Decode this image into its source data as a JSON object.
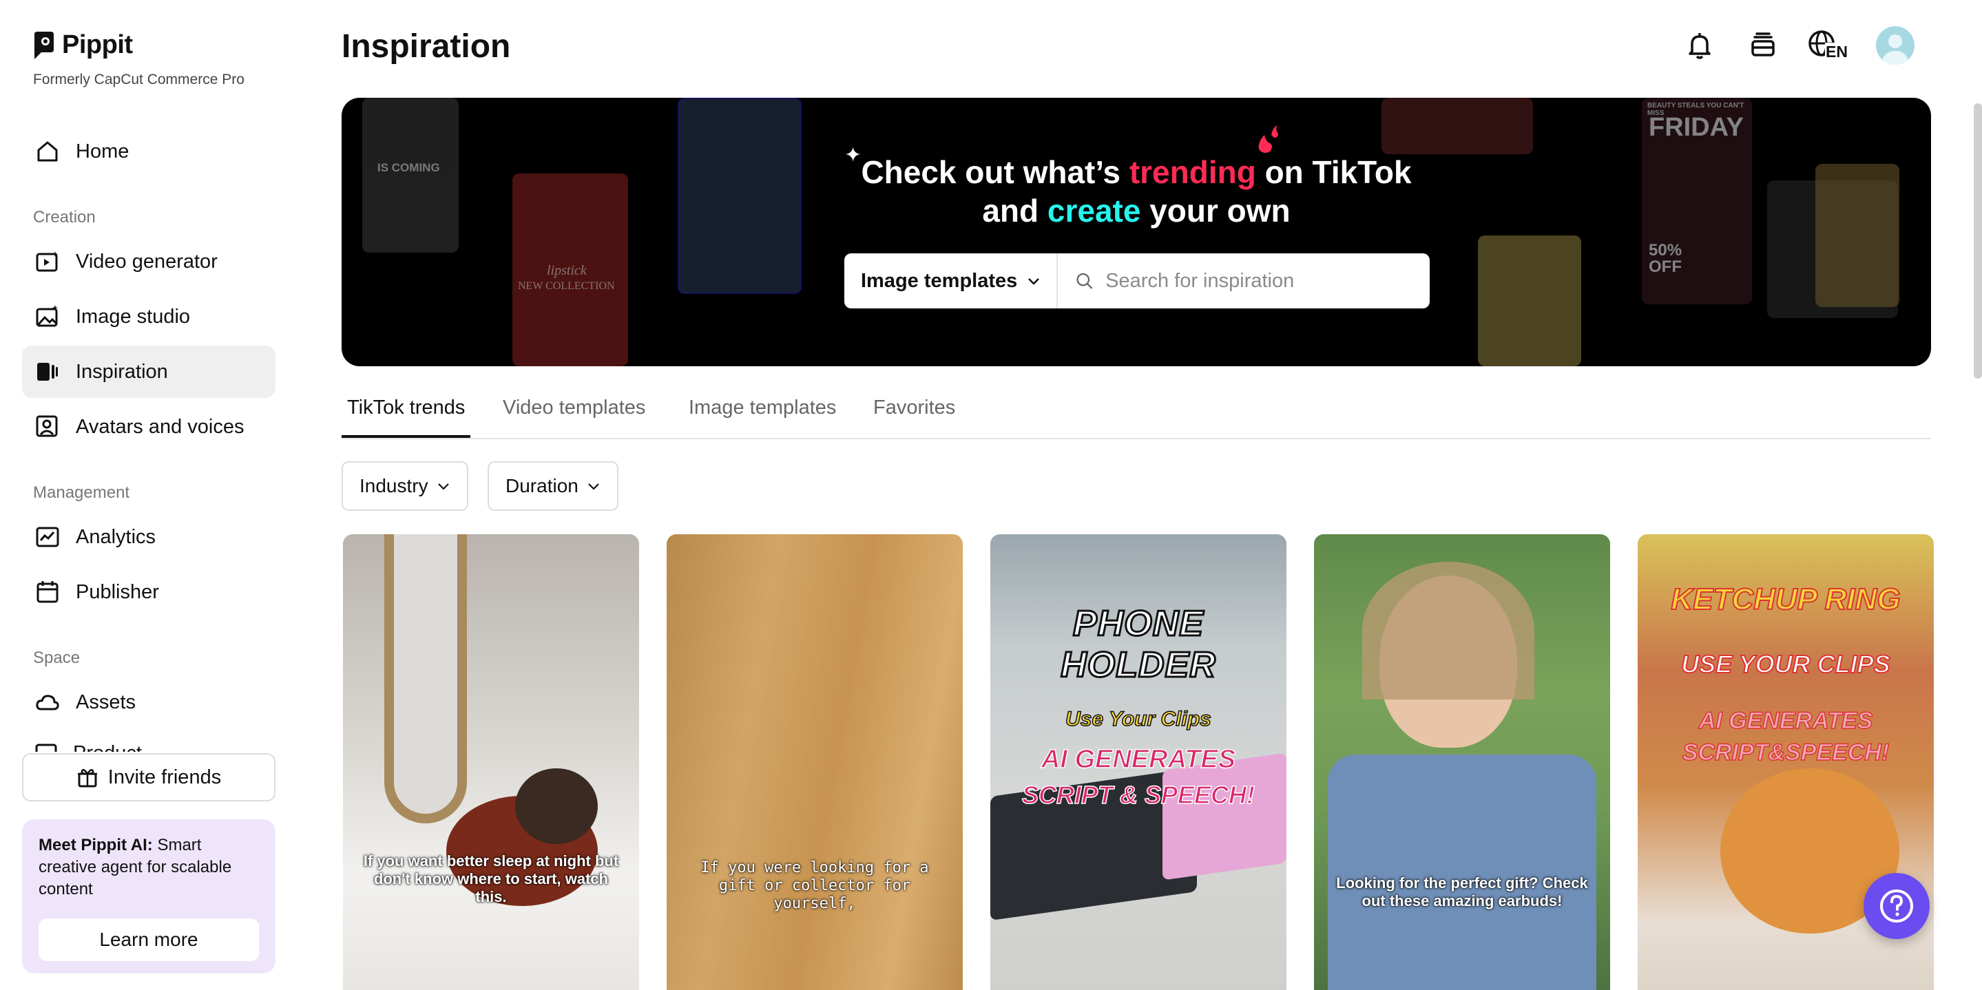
{
  "brand": {
    "name": "Pippit",
    "subtitle": "Formerly CapCut Commerce Pro"
  },
  "sidebar": {
    "home": "Home",
    "sections": {
      "creation": "Creation",
      "management": "Management",
      "space": "Space"
    },
    "items": {
      "video_generator": "Video generator",
      "image_studio": "Image studio",
      "inspiration": "Inspiration",
      "avatars": "Avatars and voices",
      "analytics": "Analytics",
      "publisher": "Publisher",
      "assets": "Assets",
      "products_partial": "Product"
    },
    "invite": "Invite friends",
    "promo": {
      "bold": "Meet Pippit AI:",
      "text": " Smart creative agent for scalable content",
      "button": "Learn more"
    }
  },
  "header": {
    "title": "Inspiration",
    "language": "EN"
  },
  "hero": {
    "line1_a": "Check out what’s ",
    "line1_highlight": "trending",
    "line1_b": " on TikTok",
    "line2_a": "and ",
    "line2_highlight": "create",
    "line2_b": " your own",
    "select_value": "Image templates",
    "search_placeholder": "Search for inspiration",
    "thumbs": {
      "coming": "IS COMING",
      "lipstick": "lipstick",
      "collection": "NEW COLLECTION",
      "friday": "FRIDAY",
      "off": "50% OFF",
      "beauty": "BEAUTY STEALS YOU CAN'T MISS"
    }
  },
  "tabs": [
    "TikTok trends",
    "Video templates",
    "Image templates",
    "Favorites"
  ],
  "filters": {
    "industry": "Industry",
    "duration": "Duration"
  },
  "cards": [
    {
      "caption": "If you want better sleep at night but don't know where to start, watch this."
    },
    {
      "caption": "If you were looking for a gift or collector for yourself,"
    },
    {
      "title": "PHONE HOLDER",
      "sub": "Use Your Clips",
      "line1": "AI GENERATES",
      "line2": "SCRIPT & SPEECH!"
    },
    {
      "caption": "Looking for the perfect gift? Check out these amazing earbuds!"
    },
    {
      "title": "KETCHUP RING",
      "sub": "USE YOUR CLIPS",
      "line1": "AI GENERATES",
      "line2": "SCRIPT&SPEECH!"
    }
  ],
  "colors": {
    "tiktok_pink": "#fe2c55",
    "tiktok_cyan": "#25f4ee",
    "help_button": "#6a4cf0",
    "promo_bg": "#efe5fb"
  }
}
